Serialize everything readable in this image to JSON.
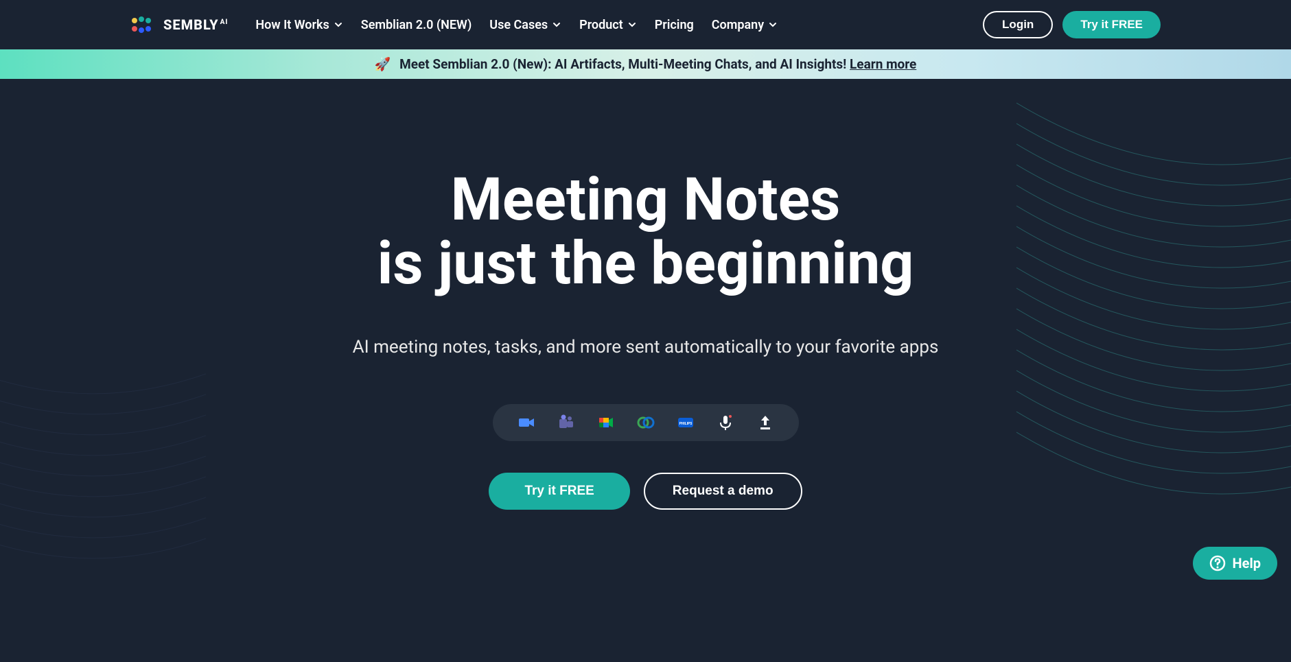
{
  "logo": {
    "text": "SEMBLY",
    "suffix": "AI"
  },
  "nav": {
    "items": [
      {
        "label": "How It Works",
        "hasDropdown": true
      },
      {
        "label": "Semblian 2.0 (NEW)",
        "hasDropdown": false
      },
      {
        "label": "Use Cases",
        "hasDropdown": true
      },
      {
        "label": "Product",
        "hasDropdown": true
      },
      {
        "label": "Pricing",
        "hasDropdown": false
      },
      {
        "label": "Company",
        "hasDropdown": true
      }
    ]
  },
  "header": {
    "login": "Login",
    "cta": "Try it FREE"
  },
  "banner": {
    "icon": "🚀",
    "text": "Meet Semblian 2.0 (New): AI Artifacts, Multi-Meeting Chats, and AI Insights! ",
    "link": "Learn more"
  },
  "hero": {
    "title_line1": "Meeting Notes",
    "title_line2": "is just the beginning",
    "subtitle": "AI meeting notes, tasks, and more sent automatically to your favorite apps",
    "cta_primary": "Try it FREE",
    "cta_secondary": "Request a demo"
  },
  "integrations": [
    {
      "name": "zoom"
    },
    {
      "name": "teams"
    },
    {
      "name": "google-meet"
    },
    {
      "name": "webex"
    },
    {
      "name": "philips"
    },
    {
      "name": "microphone"
    },
    {
      "name": "upload"
    }
  ],
  "help": {
    "label": "Help"
  }
}
